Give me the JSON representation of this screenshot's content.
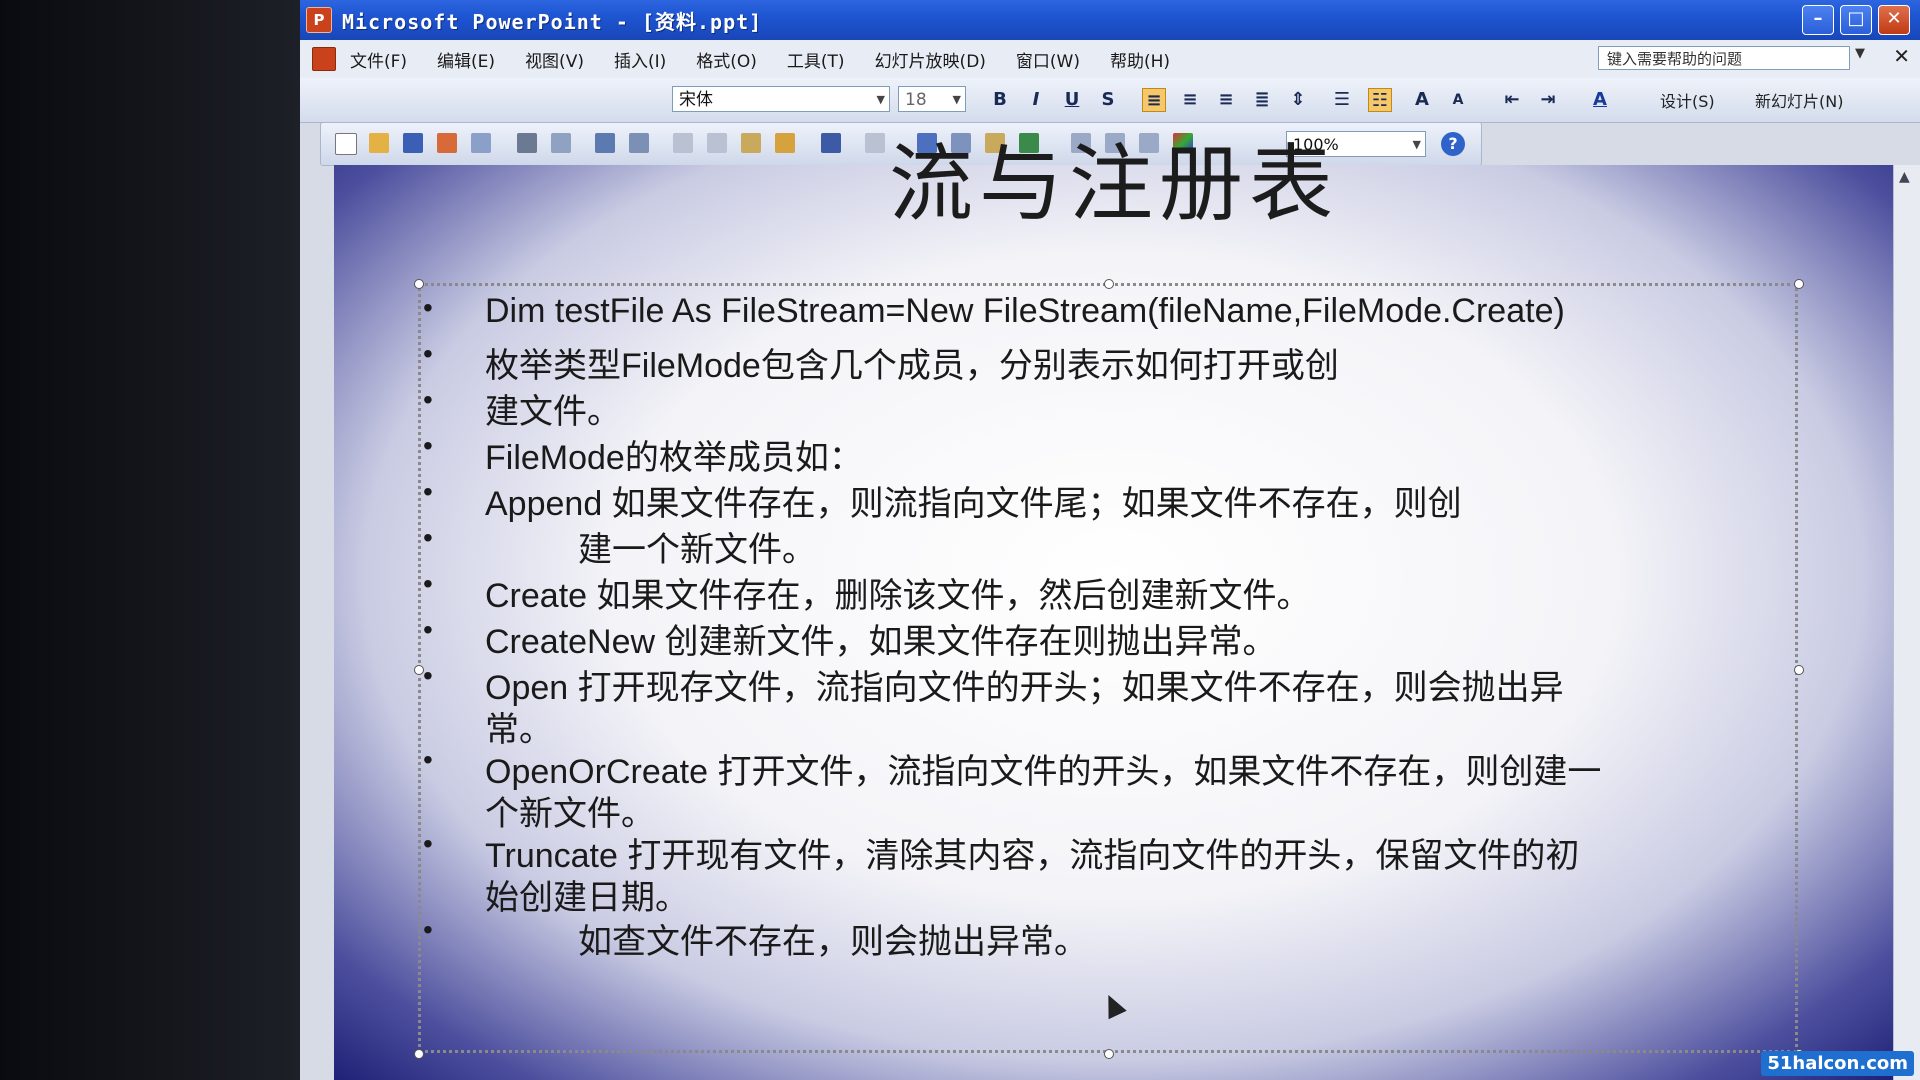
{
  "window": {
    "title": "Microsoft PowerPoint - [资料.ppt]",
    "app_icon": "powerpoint-icon",
    "controls": [
      "minimize",
      "maximize",
      "close"
    ]
  },
  "menu": {
    "items": [
      "文件(F)",
      "编辑(E)",
      "视图(V)",
      "插入(I)",
      "格式(O)",
      "工具(T)",
      "幻灯片放映(D)",
      "窗口(W)",
      "帮助(H)"
    ],
    "help_placeholder": "键入需要帮助的问题"
  },
  "format_toolbar": {
    "font": "宋体",
    "size": "18",
    "bold": "B",
    "italic": "I",
    "underline": "U",
    "shadow": "S",
    "design": "设计(S)",
    "new_slide": "新幻灯片(N)"
  },
  "standard_toolbar": {
    "zoom": "100%"
  },
  "slide": {
    "title": "流与注册表",
    "bullets": [
      {
        "text": "Dim testFile As FileStream=New FileStream(fileName,FileMode.Create)"
      },
      {
        "text": "枚举类型FileMode包含几个成员，分别表示如何打开或创"
      },
      {
        "text": "建文件。"
      },
      {
        "text": "FileMode的枚举成员如："
      },
      {
        "text": "Append    如果文件存在，则流指向文件尾；如果文件不存在，则创"
      },
      {
        "text": "建一个新文件。"
      },
      {
        "text": "Create    如果文件存在，删除该文件，然后创建新文件。"
      },
      {
        "text": "CreateNew    创建新文件，如果文件存在则抛出异常。"
      },
      {
        "text": "Open    打开现存文件，流指向文件的开头；如果文件不存在，则会抛出异"
      },
      {
        "text": "OpenOrCreate    打开文件，流指向文件的开头，如果文件不存在，则创建一"
      },
      {
        "text": "Truncate    打开现有文件，清除其内容，流指向文件的开头，保留文件的初"
      },
      {
        "text": "如查文件不存在，则会抛出异常。"
      }
    ],
    "continuations": [
      "常。",
      "个新文件。",
      "始创建日期。"
    ]
  },
  "watermark": "51halcon.com"
}
